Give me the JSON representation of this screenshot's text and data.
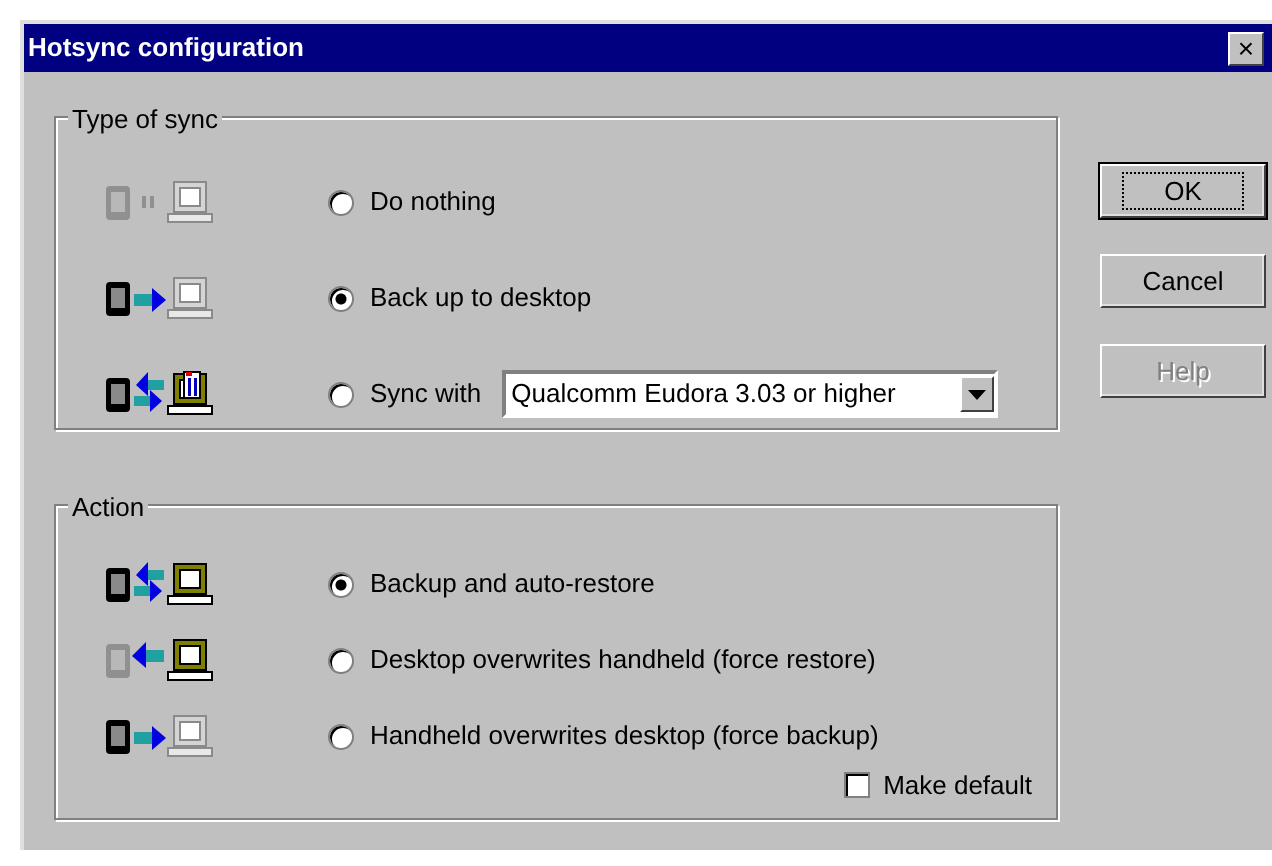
{
  "window": {
    "title": "Hotsync configuration",
    "close": "×"
  },
  "sync_type": {
    "title": "Type of sync",
    "options": [
      {
        "label": "Do nothing",
        "selected": false,
        "kind": "idle"
      },
      {
        "label": "Back up to desktop",
        "selected": true,
        "kind": "backup"
      },
      {
        "label": "Sync with",
        "selected": false,
        "kind": "sync",
        "dropdown": {
          "value": "Qualcomm Eudora 3.03 or higher"
        }
      }
    ]
  },
  "action": {
    "title": "Action",
    "options": [
      {
        "label": "Backup and auto-restore",
        "selected": true,
        "kind": "twoway"
      },
      {
        "label": "Desktop overwrites handheld (force restore)",
        "selected": false,
        "kind": "restore"
      },
      {
        "label": "Handheld overwrites desktop (force backup)",
        "selected": false,
        "kind": "backup"
      }
    ],
    "make_default": {
      "label": "Make default",
      "checked": false
    }
  },
  "buttons": [
    {
      "label": "OK",
      "default": true,
      "disabled": false
    },
    {
      "label": "Cancel",
      "default": false,
      "disabled": false
    },
    {
      "label": "Help",
      "default": false,
      "disabled": true
    }
  ]
}
